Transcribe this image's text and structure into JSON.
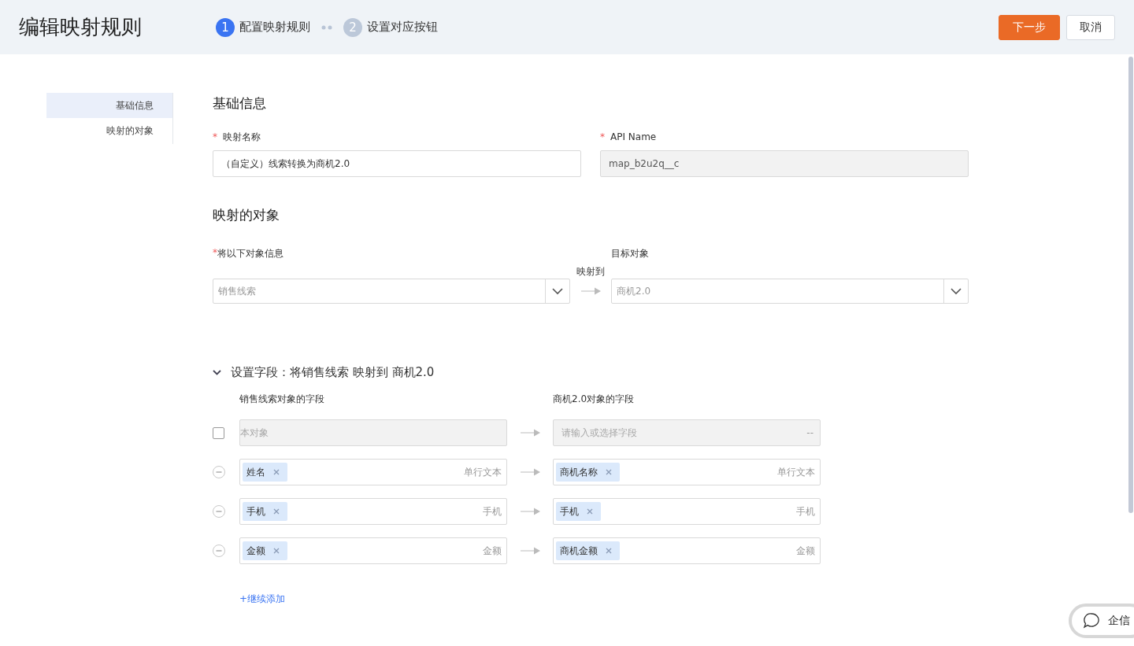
{
  "header": {
    "title": "编辑映射规则",
    "steps": [
      {
        "number": "1",
        "label": "配置映射规则",
        "selected": true
      },
      {
        "number": "2",
        "label": "设置对应按钮",
        "selected": false
      }
    ],
    "buttons": [
      {
        "label": "下一步",
        "kind": "primary"
      },
      {
        "label": "取消",
        "kind": "default"
      }
    ]
  },
  "sidebar": {
    "items": [
      {
        "label": "基础信息",
        "selected": true
      },
      {
        "label": "映射的对象",
        "selected": false
      }
    ]
  },
  "basic_info": {
    "heading": "基础信息",
    "fields": [
      {
        "required_mark": "*",
        "label": "映射名称",
        "value": "（自定义）线索转换为商机2.0",
        "disabled": false
      },
      {
        "required_mark": "*",
        "label": "API Name",
        "value": "map_b2u2q__c",
        "disabled": true
      }
    ]
  },
  "mapping_object": {
    "heading": "映射的对象",
    "source_required_mark": "*",
    "source_label": "将以下对象信息",
    "arrow_label": "映射到",
    "target_label": "目标对象",
    "source_value": "销售线索",
    "target_value": "商机2.0"
  },
  "field_section": {
    "title": "设置字段：将销售线索 映射到 商机2.0",
    "expanded": true,
    "source_column": "销售线索对象的字段",
    "target_column": "商机2.0对象的字段",
    "rows": [
      {
        "kind": "object",
        "checked": false,
        "source_placeholder": "本对象",
        "target_placeholder": "请输入或选择字段",
        "target_type": "--"
      },
      {
        "kind": "field",
        "source_tag": "姓名",
        "source_type": "单行文本",
        "target_tag": "商机名称",
        "target_type": "单行文本"
      },
      {
        "kind": "field",
        "source_tag": "手机",
        "source_type": "手机",
        "target_tag": "手机",
        "target_type": "手机"
      },
      {
        "kind": "field",
        "source_tag": "金额",
        "source_type": "金额",
        "target_tag": "商机金额",
        "target_type": "金额"
      }
    ],
    "add_link": "+继续添加"
  },
  "chat_button": {
    "label": "企信"
  }
}
